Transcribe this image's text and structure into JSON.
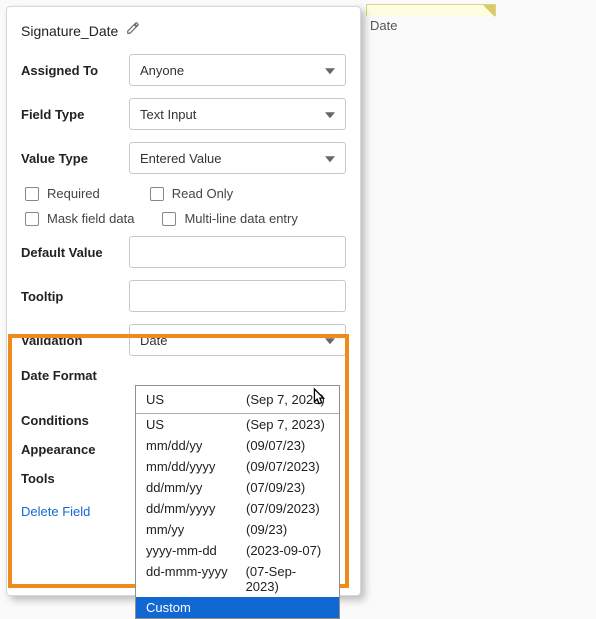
{
  "sideChip": {
    "label": "Date"
  },
  "title": "Signature_Date",
  "fields": {
    "assignedTo": {
      "label": "Assigned To",
      "value": "Anyone"
    },
    "fieldType": {
      "label": "Field Type",
      "value": "Text Input"
    },
    "valueType": {
      "label": "Value Type",
      "value": "Entered Value"
    },
    "defaultValue": {
      "label": "Default Value",
      "value": ""
    },
    "tooltip": {
      "label": "Tooltip",
      "value": ""
    },
    "validation": {
      "label": "Validation",
      "value": "Date"
    },
    "dateFormat": {
      "label": "Date Format"
    }
  },
  "checks": {
    "required": "Required",
    "readOnly": "Read Only",
    "maskField": "Mask field data",
    "multiLine": "Multi-line data entry"
  },
  "sections": {
    "conditions": "Conditions",
    "appearance": "Appearance",
    "tools": "Tools"
  },
  "deleteField": "Delete Field",
  "dateFormatDropdown": {
    "selected": {
      "fmt": "US",
      "example": "(Sep 7, 2023)"
    },
    "options": [
      {
        "fmt": "US",
        "example": "(Sep 7, 2023)"
      },
      {
        "fmt": "mm/dd/yy",
        "example": "(09/07/23)"
      },
      {
        "fmt": "mm/dd/yyyy",
        "example": "(09/07/2023)"
      },
      {
        "fmt": "dd/mm/yy",
        "example": "(07/09/23)"
      },
      {
        "fmt": "dd/mm/yyyy",
        "example": "(07/09/2023)"
      },
      {
        "fmt": "mm/yy",
        "example": "(09/23)"
      },
      {
        "fmt": "yyyy-mm-dd",
        "example": "(2023-09-07)"
      },
      {
        "fmt": "dd-mmm-yyyy",
        "example": "(07-Sep-2023)"
      },
      {
        "fmt": "Custom",
        "example": ""
      }
    ],
    "highlightedIndex": 8
  }
}
